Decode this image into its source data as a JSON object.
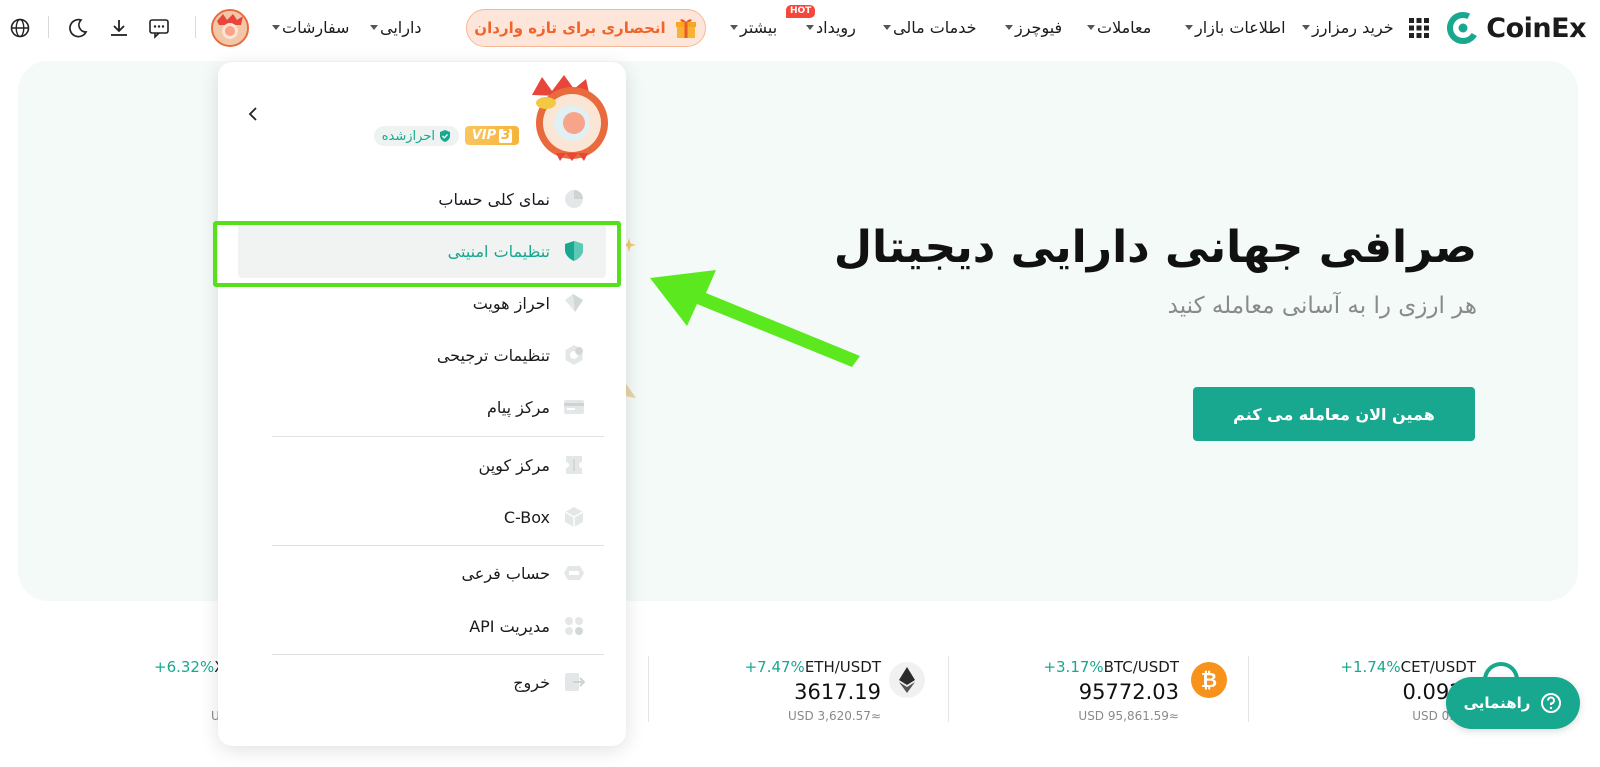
{
  "nav": {
    "logo_text": "CoinEx",
    "items": [
      {
        "label": "خرید رمزارز",
        "dropdown": true
      },
      {
        "label": "اطلاعات بازار",
        "dropdown": true
      },
      {
        "label": "معاملات",
        "dropdown": true
      },
      {
        "label": "فیوچرز",
        "dropdown": true
      },
      {
        "label": "خدمات مالی",
        "dropdown": true
      },
      {
        "label": "رویداد",
        "dropdown": true,
        "badge": "HOT"
      },
      {
        "label": "بیشتر",
        "dropdown": true
      }
    ],
    "promo_label": "انحصاری برای تازه واردان",
    "assets_label": "دارایی",
    "orders_label": "سفارشات",
    "icons": [
      "apps-grid-icon",
      "gift-icon",
      "chat-icon",
      "download-icon",
      "moon-icon",
      "globe-icon"
    ]
  },
  "hero": {
    "title": "صرافی جهانی دارایی دیجیتال",
    "subtitle": "هر ارزی را به آسانی معامله کنید",
    "cta_label": "همین الان معامله می کنم"
  },
  "account_menu": {
    "vip_label": "VIP",
    "vip_level": "3",
    "verified_label": "احرازشده",
    "items": [
      {
        "label": "نمای کلی حساب",
        "icon": "pie-chart-icon"
      },
      {
        "label": "تنظیمات امنیتی",
        "icon": "shield-icon",
        "active": true
      },
      {
        "label": "احراز هویت",
        "icon": "id-card-icon"
      },
      {
        "label": "تنظیمات ترجیحی",
        "icon": "settings-icon"
      },
      {
        "label": "مرکز پیام",
        "icon": "message-icon"
      },
      {
        "label": "مرکز کوپن",
        "icon": "coupon-icon"
      },
      {
        "label": "C-Box",
        "icon": "box-icon"
      },
      {
        "label": "حساب فرعی",
        "icon": "sub-account-icon"
      },
      {
        "label": "مدیریت API",
        "icon": "api-icon"
      },
      {
        "label": "خروج",
        "icon": "logout-icon"
      }
    ]
  },
  "ticker": [
    {
      "pair": "CET/USDT",
      "change": "+1.74%",
      "price": "0.0924",
      "usd": "USD 0.092"
    },
    {
      "pair": "BTC/USDT",
      "change": "+3.17%",
      "price": "95772.03",
      "usd": "USD 95,861.59≈"
    },
    {
      "pair": "ETH/USDT",
      "change": "+7.47%",
      "price": "3617.19",
      "usd": "USD 3,620.57≈"
    },
    {
      "pair": "XI",
      "change": "+6.32%",
      "price": "",
      "usd": "U"
    }
  ],
  "help_label": "راهنمایی",
  "colors": {
    "brand": "#17a88f",
    "highlight": "#56e01c",
    "promo": "#f0642b",
    "hot": "#f5473b",
    "btc": "#f7931a"
  }
}
